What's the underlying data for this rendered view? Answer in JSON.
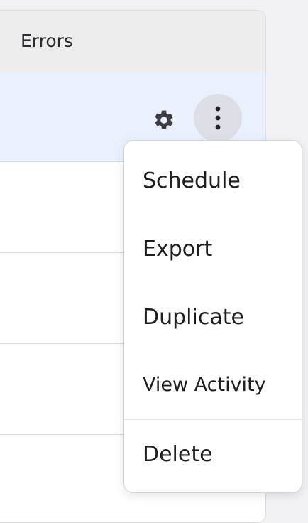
{
  "table": {
    "header": {
      "errors_label": "Errors"
    },
    "rows": [
      {
        "state": "selected"
      },
      {
        "state": "normal"
      },
      {
        "state": "normal"
      },
      {
        "state": "normal"
      }
    ]
  },
  "row_actions": {
    "settings_icon": "gear-icon",
    "more_icon": "kebab-vertical-icon"
  },
  "menu": {
    "items": [
      {
        "label": "Schedule"
      },
      {
        "label": "Export"
      },
      {
        "label": "Duplicate"
      },
      {
        "label": "View Activity"
      },
      {
        "label": "Delete"
      }
    ]
  },
  "colors": {
    "selected_row": "#eaf1fd",
    "header_bg": "#ededee",
    "active_button_bg": "#dcdfe6"
  }
}
